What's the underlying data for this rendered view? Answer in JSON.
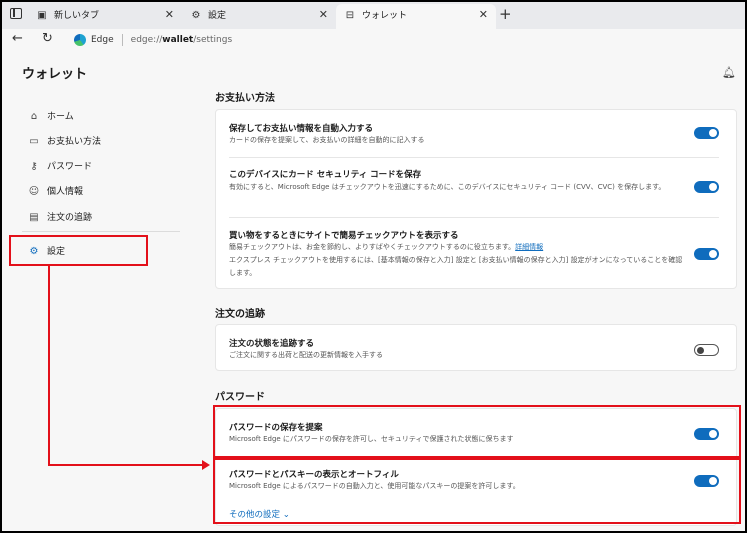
{
  "tabs": [
    {
      "label": "新しいタブ",
      "icon": "page-icon"
    },
    {
      "label": "設定",
      "icon": "gear-icon"
    },
    {
      "label": "ウォレット",
      "icon": "wallet-icon"
    }
  ],
  "address": {
    "brand": "Edge",
    "url_prefix": "edge://",
    "url_host": "wallet",
    "url_path": "/settings"
  },
  "sidebar": {
    "title": "ウォレット",
    "items": [
      {
        "label": "ホーム",
        "icon": "home-icon"
      },
      {
        "label": "お支払い方法",
        "icon": "card-icon"
      },
      {
        "label": "パスワード",
        "icon": "key-icon"
      },
      {
        "label": "個人情報",
        "icon": "person-icon"
      },
      {
        "label": "注文の追跡",
        "icon": "receipt-icon"
      },
      {
        "label": "設定",
        "icon": "gear-icon"
      }
    ]
  },
  "main": {
    "sections": [
      {
        "title": "お支払い方法",
        "rows": [
          {
            "title": "保存してお支払い情報を自動入力する",
            "desc": "カードの保存を提案して、お支払いの詳細を自動的に記入する",
            "toggle": "on"
          },
          {
            "title": "このデバイスにカード セキュリティ コードを保存",
            "desc": "有効にすると、Microsoft Edge はチェックアウトを迅速にするために、このデバイスにセキュリティ コード (CVV、CVC) を保存します。",
            "toggle": "on"
          },
          {
            "title": "買い物をするときにサイトで簡易チェックアウトを表示する",
            "desc1": "簡易チェックアウトは、お金を節約し、よりすばやくチェックアウトするのに役立ちます。",
            "link": "詳細情報",
            "desc2": "エクスプレス チェックアウトを使用するには、[基本情報の保存と入力] 設定と [お支払い情報の保存と入力] 設定がオンになっていることを確認します。",
            "toggle": "on"
          }
        ]
      },
      {
        "title": "注文の追跡",
        "rows": [
          {
            "title": "注文の状態を追跡する",
            "desc": "ご注文に関する出荷と配送の更新情報を入手する",
            "toggle": "off"
          }
        ]
      },
      {
        "title": "パスワード",
        "rows": [
          {
            "title": "パスワードの保存を提案",
            "desc": "Microsoft Edge にパスワードの保存を許可し、セキュリティで保護された状態に保ちます",
            "toggle": "on"
          },
          {
            "title": "パスワードとパスキーの表示とオートフィル",
            "desc": "Microsoft Edge によるパスワードの自動入力と、使用可能なパスキーの提案を許可します。",
            "toggle": "on"
          }
        ],
        "more_label": "その他の設定"
      }
    ]
  },
  "colors": {
    "accent": "#0f6cbd",
    "annotation": "#e3101a"
  }
}
